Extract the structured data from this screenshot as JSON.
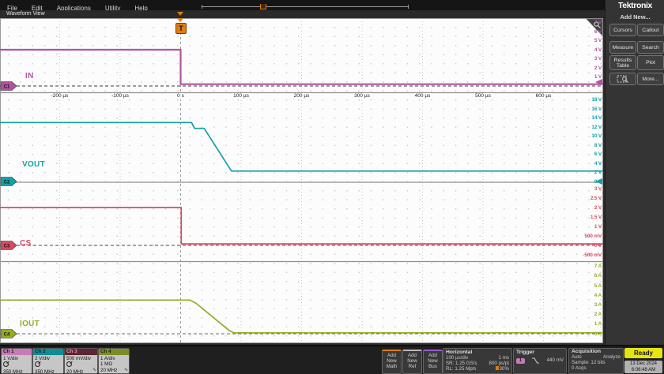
{
  "menu": {
    "items": [
      "File",
      "Edit",
      "Applications",
      "Utility",
      "Help"
    ]
  },
  "tab": {
    "label": "Waveform View"
  },
  "brand": "Tektronix",
  "side_panel": {
    "add_new_label": "Add New...",
    "buttons": [
      {
        "label": "Cursors"
      },
      {
        "label": "Callout"
      },
      {
        "label": "Measure"
      },
      {
        "label": "Search"
      },
      {
        "label": "Results Table"
      },
      {
        "label": "Plot"
      },
      {
        "label": "More..."
      }
    ]
  },
  "trigger_marker": {
    "label": "T",
    "position_percent": "30%"
  },
  "time_axis": {
    "ticks": [
      {
        "t": -200,
        "label": "-200 µs"
      },
      {
        "t": -100,
        "label": "-100 µs"
      },
      {
        "t": 0,
        "label": "0 s"
      },
      {
        "t": 100,
        "label": "100 µs"
      },
      {
        "t": 200,
        "label": "200 µs"
      },
      {
        "t": 300,
        "label": "300 µs"
      },
      {
        "t": 400,
        "label": "400 µs"
      },
      {
        "t": 500,
        "label": "500 µs"
      },
      {
        "t": 600,
        "label": "600 µs"
      }
    ]
  },
  "channels": [
    {
      "id": "C1",
      "name": "IN",
      "color": "#b153a0",
      "axis_labels": [
        "7 V",
        "6 V",
        "5 V",
        "4 V",
        "3 V",
        "2 V",
        "1 V"
      ]
    },
    {
      "id": "C2",
      "name": "VOUT",
      "color": "#12a1a8",
      "axis_labels": [
        "18 V",
        "16 V",
        "14 V",
        "12 V",
        "10 V",
        "8 V",
        "6 V",
        "4 V",
        "2 V",
        "0 V"
      ]
    },
    {
      "id": "C3",
      "name": "CS",
      "color": "#d84a63",
      "axis_labels": [
        "3 V",
        "2.5 V",
        "2 V",
        "1.5 V",
        "1 V",
        "500 mV",
        "0 V",
        "-500 mV"
      ]
    },
    {
      "id": "C4",
      "name": "IOUT",
      "color": "#94ad24",
      "axis_labels": [
        "7 A",
        "6 A",
        "5 A",
        "4 A",
        "3 A",
        "2 A",
        "1 A",
        "0 A"
      ]
    }
  ],
  "chart_data": {
    "type": "line",
    "x_unit": "µs",
    "x_range": [
      -300,
      699
    ],
    "series": [
      {
        "name": "IN",
        "channel": "C1",
        "unit": "V",
        "points": [
          [
            -300,
            4.0
          ],
          [
            0,
            4.0
          ],
          [
            0,
            0.2
          ],
          [
            699,
            0.2
          ]
        ]
      },
      {
        "name": "VOUT",
        "channel": "C2",
        "unit": "V",
        "points": [
          [
            -300,
            13.0
          ],
          [
            18,
            13.0
          ],
          [
            23,
            11.7
          ],
          [
            39,
            11.7
          ],
          [
            84,
            2.3
          ],
          [
            699,
            2.3
          ]
        ]
      },
      {
        "name": "CS",
        "channel": "C3",
        "unit": "V",
        "points": [
          [
            -300,
            2.0
          ],
          [
            1,
            2.0
          ],
          [
            1,
            0.08
          ],
          [
            699,
            0.08
          ]
        ]
      },
      {
        "name": "IOUT",
        "channel": "C4",
        "unit": "A",
        "points": [
          [
            -300,
            3.5
          ],
          [
            15,
            3.5
          ],
          [
            26,
            3.15
          ],
          [
            80,
            0.35
          ],
          [
            88,
            0.1
          ],
          [
            699,
            0.1
          ]
        ]
      }
    ],
    "trigger": {
      "source": "C1",
      "level_v": 0.44
    }
  },
  "bottom": {
    "channel_badges": [
      {
        "title": "Ch 1",
        "scale": "1 V/div",
        "row2_text": "",
        "bandwidth": "350 MHz",
        "bw_limit": false,
        "header_bg": "#c77ab8",
        "header_fg": "#2a0d24"
      },
      {
        "title": "Ch 2",
        "scale": "2 V/div",
        "row2_text": "",
        "bandwidth": "350 MHz",
        "bw_limit": false,
        "header_bg": "#0f8d96",
        "header_fg": "#062a2c"
      },
      {
        "title": "Ch 3",
        "scale": "500 mV/div",
        "row2_text": "",
        "bandwidth": "20 MHz",
        "bw_limit": true,
        "header_bg": "#5e2533",
        "header_fg": "#e39aab"
      },
      {
        "title": "Ch 4",
        "scale": "1 A/div",
        "row2_text": "1 MΩ",
        "bandwidth": "20 MHz",
        "bw_limit": true,
        "header_bg": "#7d8c26",
        "header_fg": "#1e2405"
      }
    ],
    "add_buttons": [
      {
        "label": "Add New Math",
        "accent": "#e07b12"
      },
      {
        "label": "Add New Ref",
        "accent": "#b8b8b8"
      },
      {
        "label": "Add New Bus",
        "accent": "#9b59d0"
      }
    ],
    "horizontal": {
      "title": "Horizontal",
      "scale": "100 µs/div",
      "window": "1 ms",
      "sample_rate": "SR: 1.25 GS/s",
      "resolution": "800 ps/pt",
      "record_length": "RL: 1.25 Mpts",
      "position": "30%"
    },
    "trigger": {
      "title": "Trigger",
      "source": "1",
      "slope": "falling",
      "level": "440 mV"
    },
    "acquisition": {
      "title": "Acquisition",
      "mode": "Auto",
      "analyze": "Analyze",
      "sample": "Sample: 12 bits",
      "acqs": "0 Acqs"
    },
    "status": {
      "ready": "Ready",
      "date": "13 Dec 2024",
      "time": "6:06:48 AM"
    }
  }
}
